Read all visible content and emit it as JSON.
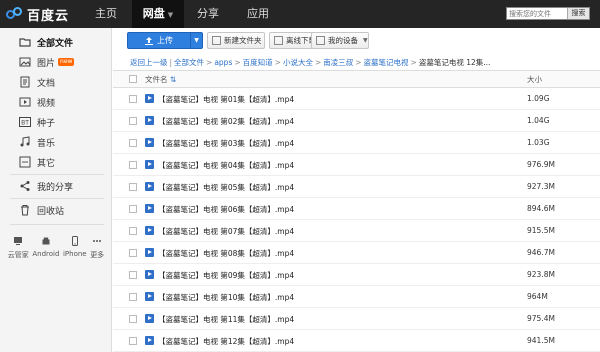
{
  "app": {
    "logo_text": "百度云"
  },
  "nav": {
    "home": "主页",
    "disk": "网盘",
    "share": "分享",
    "apps": "应用"
  },
  "search": {
    "placeholder": "搜索您的文件",
    "button": "搜索"
  },
  "sidebar": {
    "items": [
      {
        "label": "全部文件",
        "icon": "folder-icon"
      },
      {
        "label": "图片",
        "icon": "image-icon",
        "badge": "new"
      },
      {
        "label": "文档",
        "icon": "document-icon"
      },
      {
        "label": "视频",
        "icon": "video-icon"
      },
      {
        "label": "种子",
        "icon": "bt-icon"
      },
      {
        "label": "音乐",
        "icon": "music-icon"
      },
      {
        "label": "其它",
        "icon": "other-icon"
      },
      {
        "label": "我的分享",
        "icon": "share-icon"
      },
      {
        "label": "回收站",
        "icon": "trash-icon"
      }
    ],
    "devices": [
      {
        "label": "云管家",
        "icon": "monitor-icon"
      },
      {
        "label": "Android",
        "icon": "android-icon"
      },
      {
        "label": "iPhone",
        "icon": "phone-icon"
      },
      {
        "label": "更多",
        "icon": "more-icon"
      }
    ]
  },
  "toolbar": {
    "upload": "上传",
    "new_folder": "新建文件夹",
    "offline": "离线下载",
    "my_device": "我的设备"
  },
  "breadcrumb": {
    "back": "返回上一级",
    "items": [
      "全部文件",
      "apps",
      "百度知道",
      "小说大全",
      "南凌三叔",
      "盗墓笔记电视"
    ],
    "current": "盗墓笔记电视",
    "count": "12集..."
  },
  "table": {
    "headers": {
      "name": "文件名",
      "size": "大小"
    },
    "rows": [
      {
        "name": "【盗墓笔记】电视 第01集【超清】.mp4",
        "size": "1.09G"
      },
      {
        "name": "【盗墓笔记】电视 第02集【超清】.mp4",
        "size": "1.04G"
      },
      {
        "name": "【盗墓笔记】电视 第03集【超清】.mp4",
        "size": "1.03G"
      },
      {
        "name": "【盗墓笔记】电视 第04集【超清】.mp4",
        "size": "976.9M"
      },
      {
        "name": "【盗墓笔记】电视 第05集【超清】.mp4",
        "size": "927.3M"
      },
      {
        "name": "【盗墓笔记】电视 第06集【超清】.mp4",
        "size": "894.6M"
      },
      {
        "name": "【盗墓笔记】电视 第07集【超清】.mp4",
        "size": "915.5M"
      },
      {
        "name": "【盗墓笔记】电视 第08集【超清】.mp4",
        "size": "946.7M"
      },
      {
        "name": "【盗墓笔记】电视 第09集【超清】.mp4",
        "size": "923.8M"
      },
      {
        "name": "【盗墓笔记】电视 第10集【超清】.mp4",
        "size": "964M"
      },
      {
        "name": "【盗墓笔记】电视 第11集【超清】.mp4",
        "size": "975.4M"
      },
      {
        "name": "【盗墓笔记】电视 第12集【超清】.mp4",
        "size": "941.5M"
      }
    ]
  },
  "colors": {
    "topbar": "#252525",
    "accent": "#2f7fdf",
    "link": "#2a6fc8"
  }
}
